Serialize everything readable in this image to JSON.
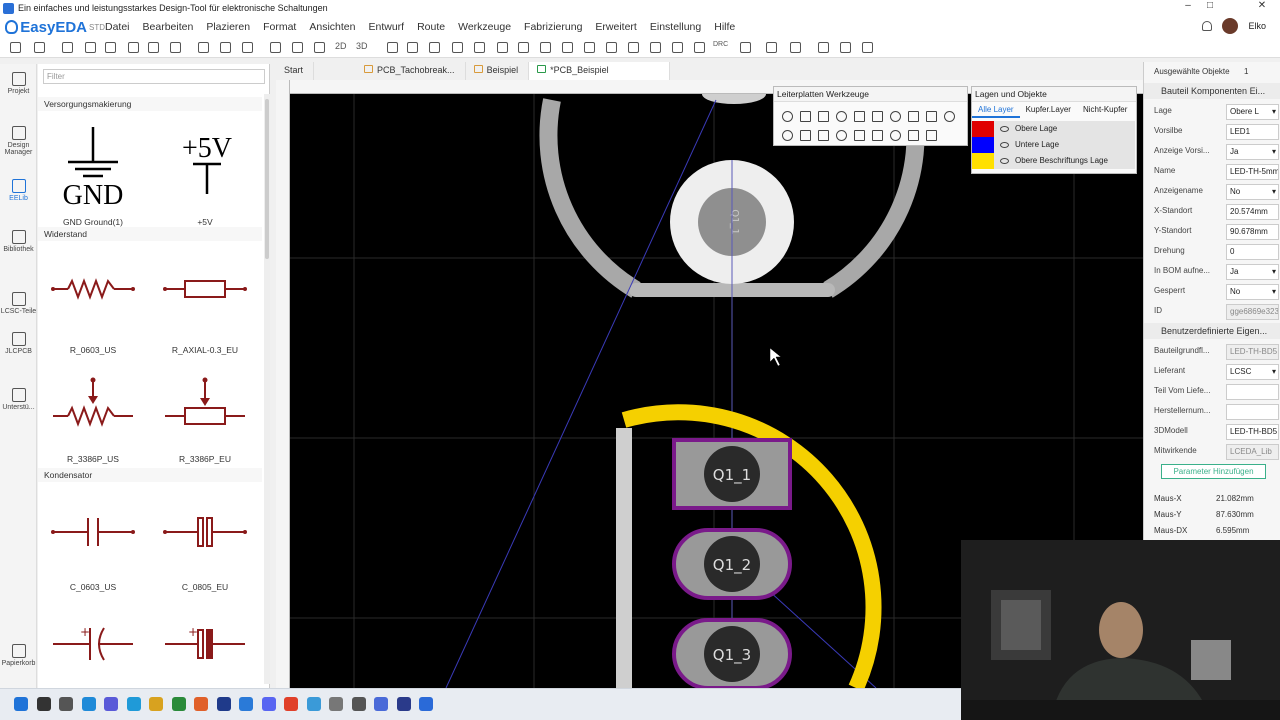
{
  "window": {
    "title": "Ein einfaches und leistungsstarkes Design-Tool für elektronische Schaltungen"
  },
  "app": {
    "logo": "EasyEDA",
    "logo_sub": "STD",
    "user": "Elko"
  },
  "menu": [
    "Datei",
    "Bearbeiten",
    "Plazieren",
    "Format",
    "Ansichten",
    "Entwurf",
    "Route",
    "Werkzeuge",
    "Fabrizierung",
    "Erweitert",
    "Einstellung",
    "Hilfe"
  ],
  "toolbar": {
    "btn_2d": "2D",
    "btn_3d": "3D",
    "btn_drc": "DRC"
  },
  "left_nav": [
    {
      "label": "Projekt",
      "icon": "folder-icon"
    },
    {
      "label": "Design Manager",
      "icon": "list-icon"
    },
    {
      "label": "EELib",
      "icon": "chip-icon"
    },
    {
      "label": "Bibliothek",
      "icon": "search-icon"
    },
    {
      "label": "LCSC-Teile",
      "icon": "lcsc-icon"
    },
    {
      "label": "JLCPCB",
      "icon": "jlc-icon"
    },
    {
      "label": "Unterstü...",
      "icon": "help-icon"
    },
    {
      "label": "Papierkorb",
      "icon": "trash-icon"
    }
  ],
  "library": {
    "filter_placeholder": "Filter",
    "categories": [
      "Versorgungsmakierung",
      "Widerstand",
      "Kondensator"
    ],
    "components": [
      "GND Ground(1)",
      "+5V",
      "R_0603_US",
      "R_AXIAL-0.3_EU",
      "R_3386P_US",
      "R_3386P_EU",
      "C_0603_US",
      "C_0805_EU"
    ],
    "gnd_symbol": "GND",
    "vcc_symbol": "+5V"
  },
  "tabs": [
    "Start",
    "PCB_Tachobreak...",
    "Beispiel",
    "*PCB_Beispiel"
  ],
  "pcb": {
    "pads": [
      "Q1_1",
      "Q1_2",
      "Q1_3"
    ],
    "top_pad": "Q1_1",
    "silk_color": "#f5d000",
    "pad_outline": "#7a1a8a"
  },
  "pcb_tools": {
    "title": "Leiterplatten Werkzeuge"
  },
  "layers_panel": {
    "title": "Lagen und Objekte",
    "tabs": [
      "Alle Layer",
      "Kupfer.Layer",
      "Nicht-Kupfer"
    ],
    "rows": [
      {
        "name": "Obere Lage",
        "color": "#e00000"
      },
      {
        "name": "Untere Lage",
        "color": "#0000ff"
      },
      {
        "name": "Obere Beschriftungs Lage",
        "color": "#ffe000"
      }
    ]
  },
  "properties": {
    "header": "Ausgewählte Objekte",
    "count": "1",
    "section1": "Bauteil Komponenten Ei...",
    "rows": [
      {
        "label": "Lage",
        "value": "Obere L"
      },
      {
        "label": "Vorsilbe",
        "value": "LED1"
      },
      {
        "label": "Anzeige Vorsi...",
        "value": "Ja"
      },
      {
        "label": "Name",
        "value": "LED-TH-5mm"
      },
      {
        "label": "Anzeigename",
        "value": "No"
      },
      {
        "label": "X-Standort",
        "value": "20.574mm"
      },
      {
        "label": "Y-Standort",
        "value": "90.678mm"
      },
      {
        "label": "Drehung",
        "value": "0"
      },
      {
        "label": "In BOM aufne...",
        "value": "Ja"
      },
      {
        "label": "Gesperrt",
        "value": "No"
      },
      {
        "label": "ID",
        "value": "gge6869e323"
      }
    ],
    "section2": "Benutzerdefinierte Eigen...",
    "rows2": [
      {
        "label": "Bauteilgrundfl...",
        "value": "LED-TH-BD5"
      },
      {
        "label": "Lieferant",
        "value": "LCSC"
      },
      {
        "label": "Teil Vom Liefe...",
        "value": ""
      },
      {
        "label": "Herstellernum...",
        "value": ""
      },
      {
        "label": "3DModell",
        "value": "LED-TH-BD5"
      },
      {
        "label": "Mitwirkende",
        "value": "LCEDA_Lib"
      }
    ],
    "add_param": "Parameter Hinzufügen",
    "mouse": [
      {
        "label": "Maus-X",
        "value": "21.082mm"
      },
      {
        "label": "Maus-Y",
        "value": "87.630mm"
      },
      {
        "label": "Maus-DX",
        "value": "6.595mm"
      }
    ]
  }
}
